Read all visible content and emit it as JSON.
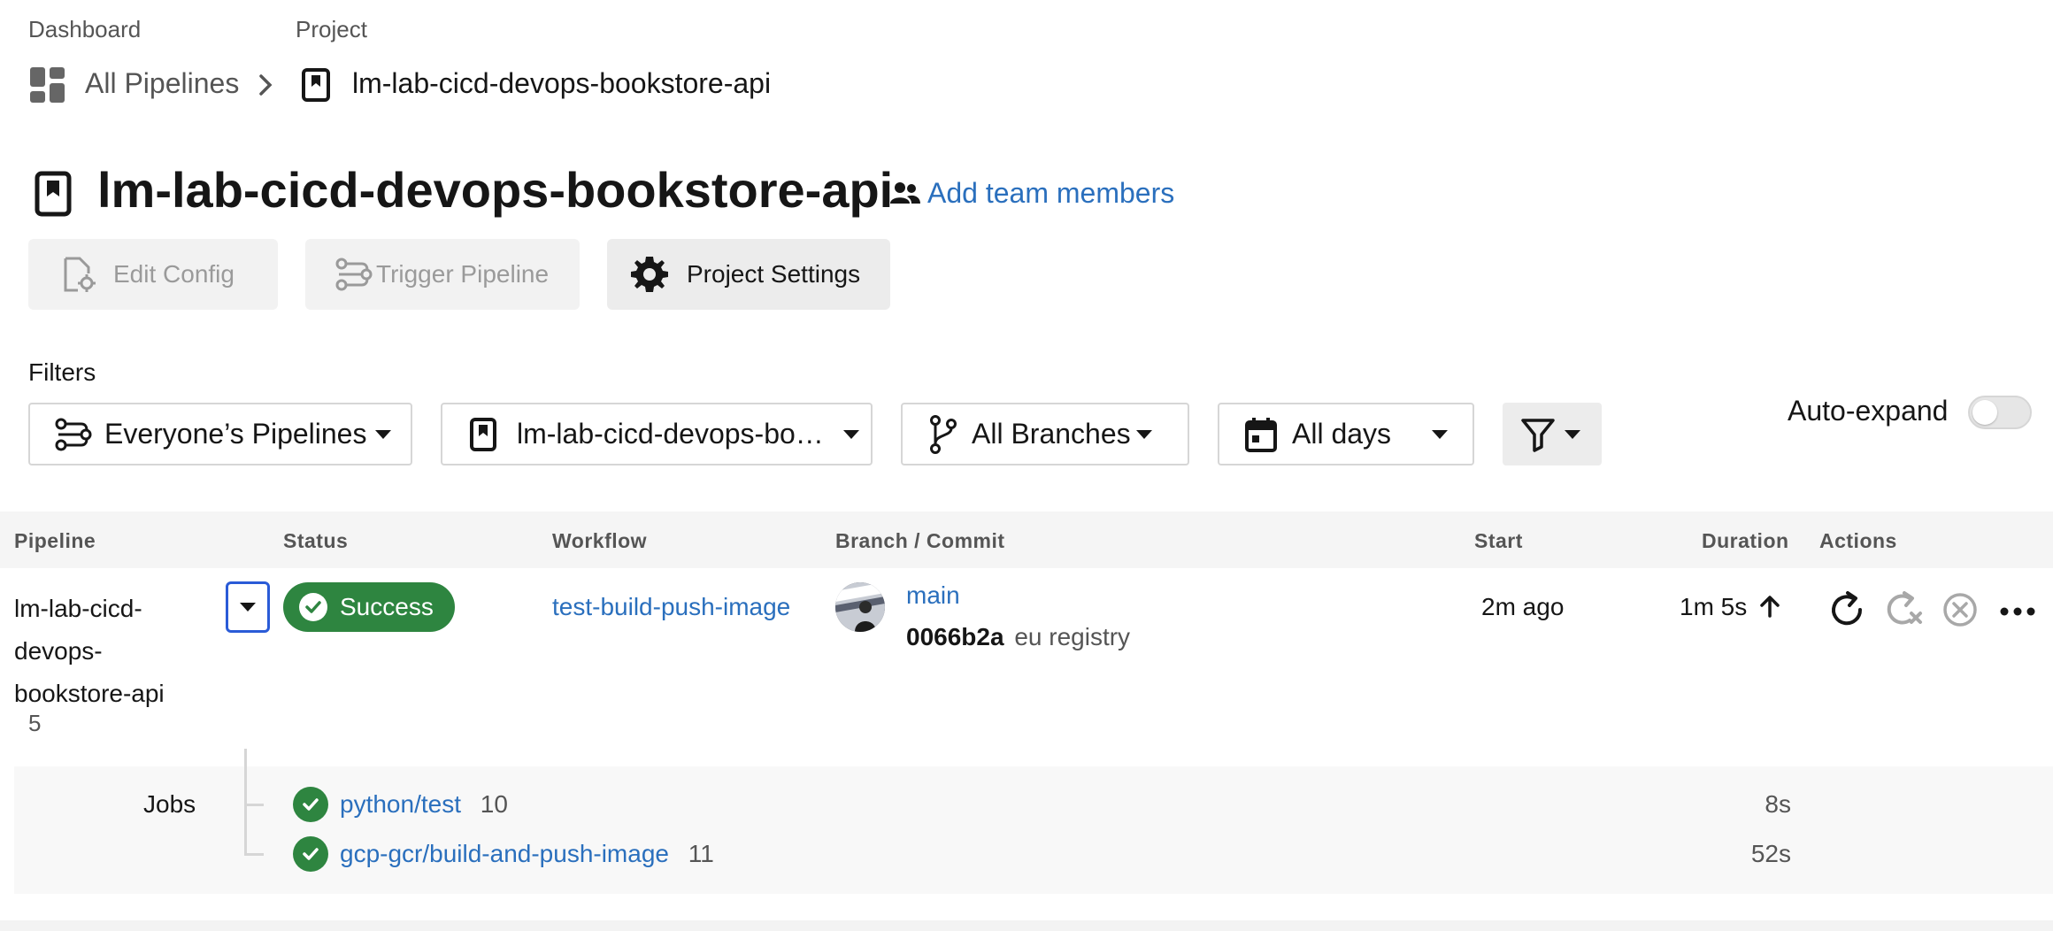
{
  "breadcrumb": {
    "dashboard_label": "Dashboard",
    "project_label": "Project",
    "all_pipelines": "All Pipelines",
    "project_name": "lm-lab-cicd-devops-bookstore-api"
  },
  "header": {
    "title": "lm-lab-cicd-devops-bookstore-api",
    "add_team_members": "Add team members"
  },
  "actions": {
    "edit_config": "Edit Config",
    "trigger_pipeline": "Trigger Pipeline",
    "project_settings": "Project Settings"
  },
  "filters": {
    "label": "Filters",
    "owner": "Everyone’s Pipelines",
    "project": "lm-lab-cicd-devops-bo…",
    "branches": "All Branches",
    "days": "All days",
    "auto_expand_label": "Auto-expand",
    "auto_expand_on": false
  },
  "table": {
    "headers": {
      "pipeline": "Pipeline",
      "status": "Status",
      "workflow": "Workflow",
      "branch_commit": "Branch / Commit",
      "start": "Start",
      "duration": "Duration",
      "actions": "Actions"
    },
    "row": {
      "pipeline_line1": "lm-lab-cicd-",
      "pipeline_line2": "devops-",
      "pipeline_line3": "bookstore-api",
      "pipeline_number": "5",
      "status": "Success",
      "workflow": "test-build-push-image",
      "branch": "main",
      "commit_hash": "0066b2a",
      "commit_message": "eu registry",
      "start": "2m ago",
      "duration": "1m 5s"
    },
    "jobs": {
      "label": "Jobs",
      "items": [
        {
          "name": "python/test",
          "number": "10",
          "duration": "8s"
        },
        {
          "name": "gcp-gcr/build-and-push-image",
          "number": "11",
          "duration": "52s"
        }
      ]
    }
  },
  "colors": {
    "link": "#2a6fbd",
    "success": "#2e8540",
    "expand_border": "#2a5bd7"
  }
}
